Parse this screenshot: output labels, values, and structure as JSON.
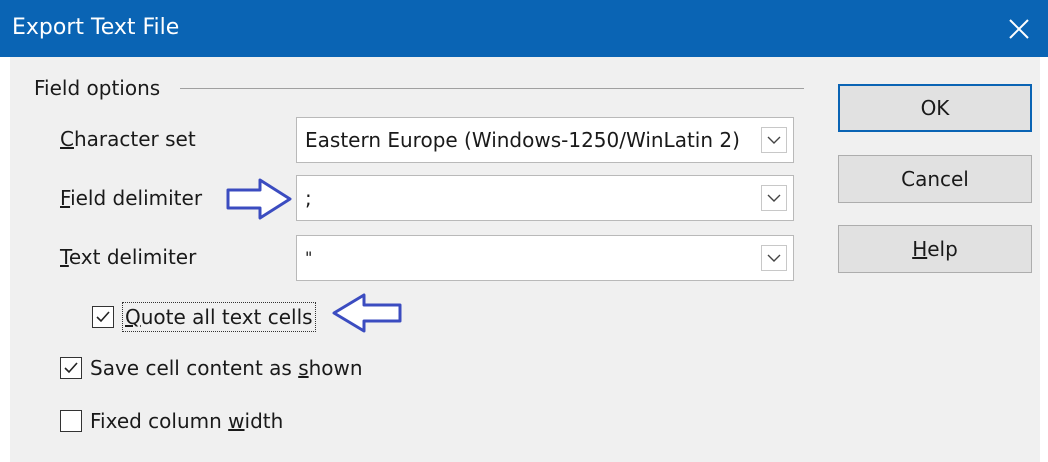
{
  "window": {
    "title": "Export Text File"
  },
  "field_options": {
    "title": "Field options",
    "character_set": {
      "label_prefix": "",
      "label_mnemonic": "C",
      "label_rest": "haracter set",
      "value": "Eastern Europe (Windows-1250/WinLatin 2)"
    },
    "field_delimiter": {
      "label_prefix": "",
      "label_mnemonic": "F",
      "label_rest": "ield delimiter",
      "value": ";"
    },
    "text_delimiter": {
      "label_prefix": "",
      "label_mnemonic": "T",
      "label_rest": "ext delimiter",
      "value": "\""
    },
    "quote_all": {
      "prefix": "",
      "mnemonic": "Q",
      "rest": "uote all text cells",
      "checked": true
    },
    "save_as_shown": {
      "prefix": "Save cell content as ",
      "mnemonic": "s",
      "rest": "hown",
      "checked": true
    },
    "fixed_width": {
      "prefix": "Fixed column ",
      "mnemonic": "w",
      "rest": "idth",
      "checked": false
    }
  },
  "buttons": {
    "ok": "OK",
    "cancel": "Cancel",
    "help_mnemonic": "H",
    "help_rest": "elp"
  },
  "colors": {
    "titlebar": "#0a64b4",
    "annotation_arrow": "#3b4cc0"
  },
  "icons": {
    "close": "close-icon",
    "dropdown": "chevron-down-icon",
    "check": "check-icon",
    "annotation": "arrow-annotation-icon"
  }
}
